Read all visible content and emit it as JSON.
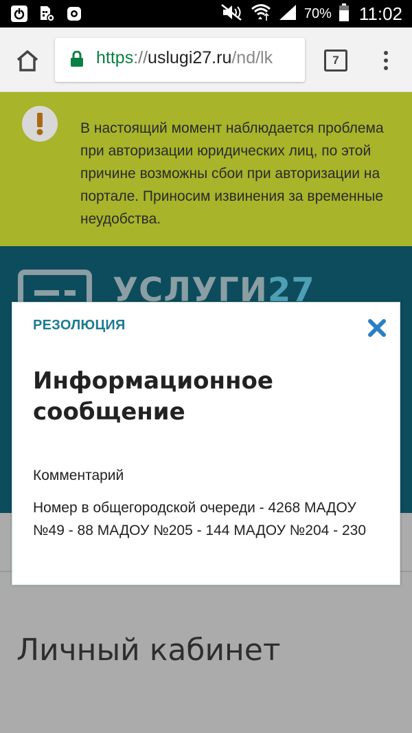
{
  "status_bar": {
    "battery_percent": "70%",
    "time": "11:02"
  },
  "browser": {
    "url_scheme": "https",
    "url_separator": "://",
    "url_host": "uslugi27.ru",
    "url_path": "/nd/lk",
    "tab_count": "7"
  },
  "banner": {
    "text": "В настоящий момент наблюдается проблема при авторизации юридических лиц, по этой причине возможны сбои при авторизации на портале. Приносим извинения за временные неудобства."
  },
  "site": {
    "logo_word": "УСЛУГИ",
    "logo_number": "27",
    "page_title": "Личный кабинет"
  },
  "modal": {
    "kicker": "РЕЗОЛЮЦИЯ",
    "title": "Информационное сообщение",
    "comment_label": "Комментарий",
    "comment_text": "Номер в общегородской очереди - 4268 МАДОУ №49 - 88 МАДОУ №205 - 144 МАДОУ №204 - 230"
  },
  "colors": {
    "banner": "#a8b42a",
    "header": "#0d4c5c",
    "accent": "#1d7a92",
    "close": "#2a7fc6"
  }
}
